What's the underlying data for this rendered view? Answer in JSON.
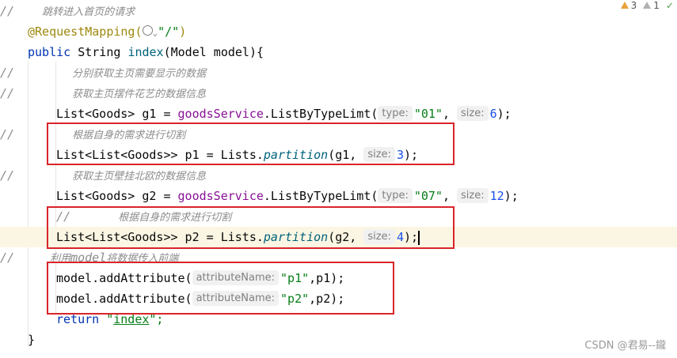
{
  "inspections": {
    "warnings": "3",
    "weak_warnings": "1"
  },
  "lines": {
    "l1_slashes": "//",
    "l1_comment": "跳转进入首页的请求",
    "l2_annotation": "@RequestMapping(",
    "l2_string": "\"/\"",
    "l2_close": ")",
    "l3_public": "public",
    "l3_type": " String ",
    "l3_method": "index",
    "l3_rest": "(Model model){",
    "l4_slashes": "//",
    "l4_comment": "分别获取主页需要显示的数据",
    "l5_slashes": "//",
    "l5_comment": "获取主页摆件花艺的数据信息",
    "l6_prefix": "List<Goods> g1 = ",
    "l6_field": "goodsService",
    "l6_call": ".ListByTypeLimt(",
    "l6_hint1": "type:",
    "l6_str": "\"01\"",
    "l6_comma": ", ",
    "l6_hint2": "size:",
    "l6_num": "6",
    "l6_end": ");",
    "l7_slashes": "//",
    "l7_comment": "根据自身的需求进行切割",
    "l8_prefix": "List<List<Goods>> p1 = Lists.",
    "l8_method": "partition",
    "l8_args": "(g1, ",
    "l8_hint": "size:",
    "l8_num": "3",
    "l8_end": ");",
    "l9_slashes": "//",
    "l9_comment": "获取主页壁挂北欧的数据信息",
    "l10_prefix": "List<Goods> g2 = ",
    "l10_field": "goodsService",
    "l10_call": ".ListByTypeLimt(",
    "l10_hint1": "type:",
    "l10_str": "\"07\"",
    "l10_comma": ", ",
    "l10_hint2": "size:",
    "l10_num": "12",
    "l10_end": ");",
    "l11_slashes": "//",
    "l11_comment": "根据自身的需求进行切割",
    "l12_prefix": "List<List<Goods>> p2 = Lists.",
    "l12_method": "partition",
    "l12_args": "(g2, ",
    "l12_hint": "size:",
    "l12_num": "4",
    "l12_end": ");",
    "l13_slashes": "//",
    "l13_comment_a": "利用",
    "l13_comment_b": "model",
    "l13_comment_c": "将数据传入前端",
    "l14_call": "model.addAttribute(",
    "l14_hint": "attributeName:",
    "l14_str": "\"p1\"",
    "l14_end": ",p1);",
    "l15_call": "model.addAttribute(",
    "l15_hint": "attributeName:",
    "l15_str": "\"p2\"",
    "l15_end": ",p2);",
    "l16_return": "return",
    "l16_q1": " \"",
    "l16_str": "index",
    "l16_q2": "\";",
    "l17_brace": "}"
  },
  "watermark": "CSDN @君易--鑨",
  "colors": {
    "highlight_box": "#d9242a",
    "current_line": "#fbf6e3"
  },
  "icons": [
    "globe-icon",
    "chevron-down-icon",
    "warning-icon",
    "weak-warning-icon",
    "check-icon",
    "text-caret"
  ]
}
